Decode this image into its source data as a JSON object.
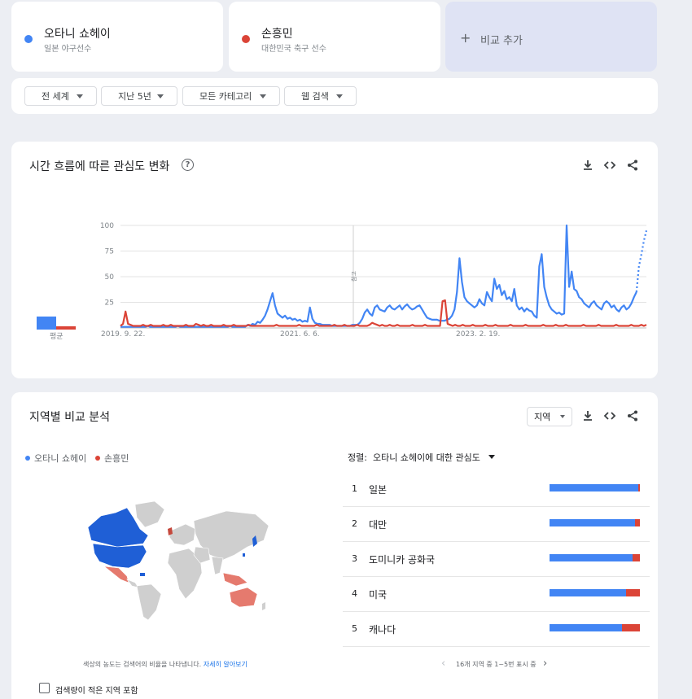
{
  "terms": [
    {
      "name": "오타니 쇼헤이",
      "sub": "일본 야구선수",
      "color": "#4285f4"
    },
    {
      "name": "손흥민",
      "sub": "대한민국 축구 선수",
      "color": "#db4437"
    }
  ],
  "add_compare": {
    "label": "비교 추가",
    "icon": "plus-icon"
  },
  "filters": [
    {
      "label": "전 세계"
    },
    {
      "label": "지난 5년"
    },
    {
      "label": "모든 카테고리"
    },
    {
      "label": "웹 검색"
    }
  ],
  "interest_over_time": {
    "title": "시간 흐름에 따른 관심도 변화",
    "average_label": "평균",
    "note_label": "참고"
  },
  "chart_data": {
    "type": "line",
    "title": "",
    "xlabel": "",
    "ylabel": "",
    "ylim": [
      0,
      100
    ],
    "yticks": [
      25,
      50,
      75,
      100
    ],
    "xtick_labels": [
      "2019. 9. 22.",
      "2021. 6. 6.",
      "2023. 2. 19."
    ],
    "grid": true,
    "averages": [
      {
        "name": "오타니 쇼헤이",
        "value": 13
      },
      {
        "name": "손흥민",
        "value": 3
      }
    ],
    "series": [
      {
        "name": "오타니 쇼헤이",
        "color": "#4285f4",
        "values": [
          1,
          1,
          1,
          1,
          1,
          1,
          1,
          1,
          1,
          1,
          1,
          2,
          1,
          1,
          1,
          1,
          1,
          1,
          1,
          1,
          1,
          1,
          1,
          2,
          1,
          1,
          1,
          1,
          1,
          1,
          1,
          1,
          1,
          1,
          1,
          1,
          1,
          1,
          1,
          1,
          1,
          1,
          1,
          1,
          2,
          1,
          1,
          1,
          1,
          1,
          1,
          3,
          2,
          4,
          3,
          6,
          5,
          8,
          12,
          18,
          26,
          34,
          22,
          14,
          12,
          10,
          12,
          9,
          10,
          8,
          9,
          7,
          8,
          6,
          7,
          6,
          20,
          9,
          5,
          4,
          4,
          3,
          3,
          3,
          3,
          2,
          2,
          2,
          2,
          2,
          2,
          2,
          2,
          3,
          3,
          3,
          5,
          9,
          15,
          18,
          14,
          12,
          20,
          22,
          18,
          17,
          16,
          20,
          22,
          19,
          18,
          20,
          22,
          18,
          21,
          23,
          20,
          18,
          19,
          21,
          22,
          18,
          14,
          10,
          9,
          8,
          8,
          8,
          7,
          7,
          7,
          8,
          9,
          12,
          18,
          35,
          68,
          45,
          30,
          26,
          24,
          22,
          20,
          22,
          28,
          24,
          22,
          35,
          30,
          26,
          48,
          38,
          42,
          32,
          36,
          28,
          30,
          26,
          38,
          22,
          18,
          20,
          16,
          19,
          17,
          16,
          12,
          10,
          60,
          72,
          40,
          30,
          22,
          18,
          16,
          14,
          15,
          13,
          14,
          100,
          40,
          55,
          38,
          36,
          30,
          28,
          24,
          22,
          20,
          24,
          26,
          22,
          20,
          18,
          24,
          26,
          24,
          20,
          22,
          18,
          16,
          20,
          22,
          18,
          20,
          24,
          30,
          35,
          60,
          72,
          85,
          95
        ]
      },
      {
        "name": "손흥민",
        "color": "#db4437",
        "values": [
          2,
          4,
          16,
          4,
          3,
          2,
          2,
          2,
          2,
          3,
          2,
          2,
          3,
          2,
          2,
          2,
          2,
          3,
          2,
          2,
          3,
          2,
          2,
          2,
          2,
          2,
          3,
          2,
          2,
          2,
          4,
          3,
          2,
          3,
          2,
          2,
          3,
          2,
          2,
          2,
          2,
          3,
          2,
          2,
          2,
          3,
          2,
          2,
          2,
          2,
          2,
          3,
          2,
          2,
          2,
          2,
          2,
          2,
          2,
          2,
          2,
          2,
          3,
          2,
          2,
          2,
          2,
          2,
          2,
          2,
          2,
          3,
          2,
          2,
          2,
          2,
          2,
          2,
          3,
          2,
          2,
          2,
          2,
          2,
          2,
          3,
          2,
          2,
          2,
          3,
          2,
          2,
          2,
          2,
          3,
          2,
          2,
          2,
          2,
          3,
          5,
          4,
          3,
          2,
          3,
          2,
          2,
          3,
          2,
          2,
          3,
          2,
          2,
          2,
          2,
          2,
          3,
          2,
          2,
          2,
          2,
          3,
          2,
          2,
          2,
          2,
          2,
          2,
          26,
          27,
          4,
          3,
          2,
          3,
          2,
          2,
          3,
          2,
          2,
          2,
          3,
          2,
          2,
          2,
          2,
          3,
          2,
          2,
          2,
          3,
          2,
          2,
          2,
          2,
          2,
          3,
          2,
          2,
          2,
          2,
          2,
          3,
          2,
          2,
          2,
          2,
          2,
          2,
          3,
          2,
          2,
          2,
          2,
          3,
          2,
          2,
          2,
          3,
          2,
          2,
          2,
          2,
          2,
          2,
          3,
          2,
          2,
          2,
          2,
          2,
          3,
          2,
          2,
          2,
          2,
          2,
          2,
          3,
          2,
          2,
          2,
          2,
          2,
          3,
          2,
          2,
          2,
          3,
          2,
          3
        ]
      }
    ]
  },
  "regional": {
    "title": "지역별 비교 분석",
    "region_select": "지역",
    "legend": [
      {
        "name": "오타니 쇼헤이",
        "color": "#4285f4"
      },
      {
        "name": "손흥민",
        "color": "#db4437"
      }
    ],
    "sort_prefix": "정렬:",
    "sort_value": "오타니 쇼헤이에 대한 관심도",
    "rows": [
      {
        "rank": "1",
        "name": "일본",
        "share_a": 0.98,
        "share_b": 0.02
      },
      {
        "rank": "2",
        "name": "대만",
        "share_a": 0.95,
        "share_b": 0.05
      },
      {
        "rank": "3",
        "name": "도미니카 공화국",
        "share_a": 0.92,
        "share_b": 0.08
      },
      {
        "rank": "4",
        "name": "미국",
        "share_a": 0.85,
        "share_b": 0.15
      },
      {
        "rank": "5",
        "name": "캐나다",
        "share_a": 0.8,
        "share_b": 0.2
      }
    ],
    "map_note": "색상의 농도는 검색어의 비율을 나타냅니다.",
    "map_note_link": "자세히 알아보기",
    "pager_text": "16개 지역 중 1~5번 표시 중",
    "low_volume_label": "검색량이 적은 지역 포함"
  }
}
